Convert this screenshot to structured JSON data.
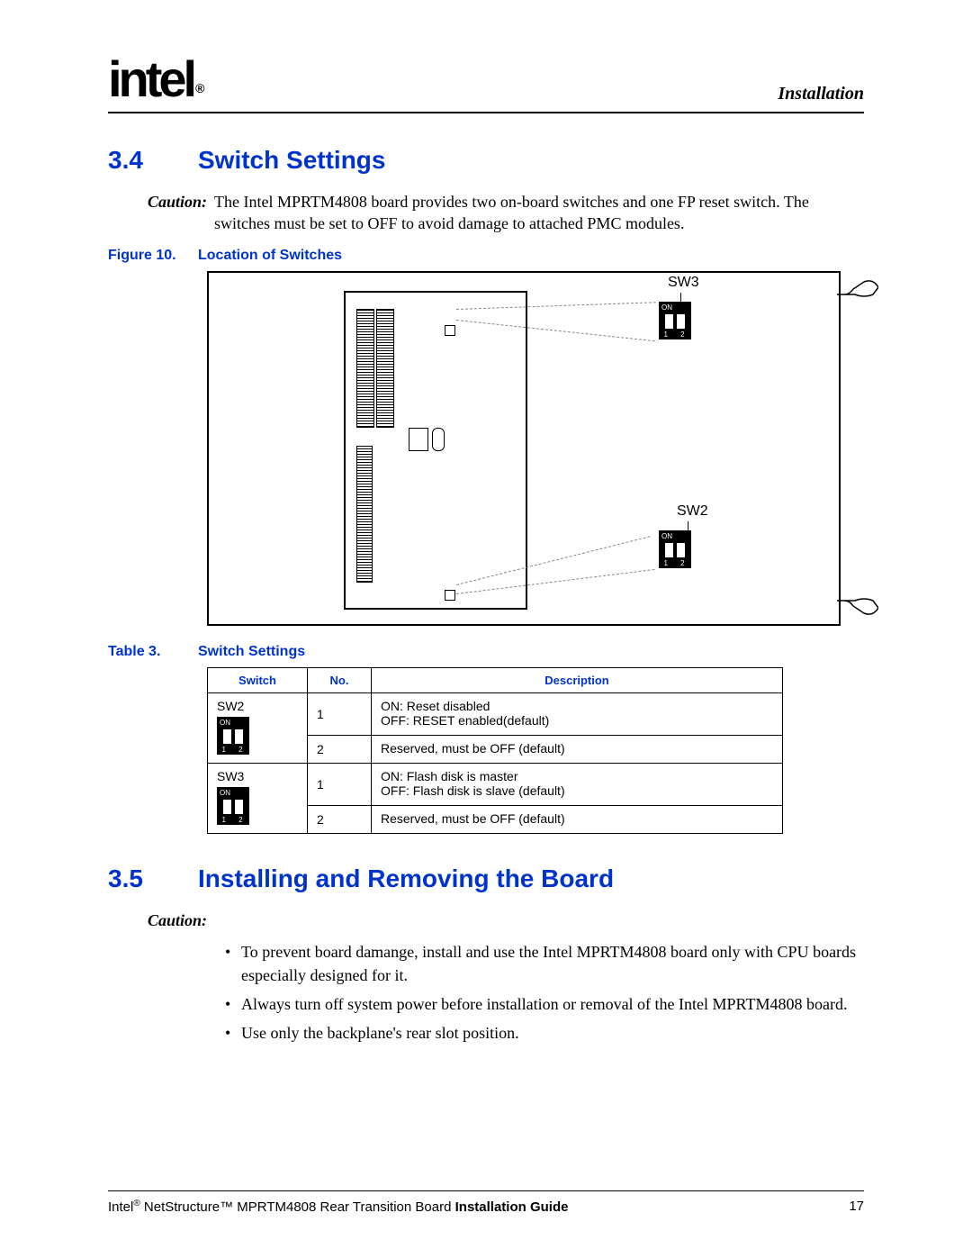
{
  "header": {
    "logo_text": "intel",
    "reg_mark": "®",
    "section_name": "Installation"
  },
  "section34": {
    "number": "3.4",
    "title": "Switch Settings",
    "caution_label": "Caution:",
    "caution_text": "The Intel MPRTM4808 board provides two on-board switches and one FP reset switch. The switches must be set to OFF to avoid damage to attached PMC modules."
  },
  "figure": {
    "label": "Figure 10.",
    "title": "Location of Switches",
    "sw3_label": "SW3",
    "sw2_label": "SW2",
    "dip_on": "ON",
    "dip_nums": "1 2"
  },
  "table": {
    "label": "Table 3.",
    "title": "Switch Settings",
    "headers": {
      "c1": "Switch",
      "c2": "No.",
      "c3": "Description"
    },
    "rows": [
      {
        "switch": "SW2",
        "sub": [
          {
            "no": "1",
            "desc_l1": "ON: Reset disabled",
            "desc_l2": "OFF: RESET enabled(default)"
          },
          {
            "no": "2",
            "desc_l1": "Reserved, must be OFF (default)",
            "desc_l2": ""
          }
        ]
      },
      {
        "switch": "SW3",
        "sub": [
          {
            "no": "1",
            "desc_l1": "ON: Flash disk is master",
            "desc_l2": "OFF: Flash disk is slave (default)"
          },
          {
            "no": "2",
            "desc_l1": "Reserved, must be OFF (default)",
            "desc_l2": ""
          }
        ]
      }
    ]
  },
  "section35": {
    "number": "3.5",
    "title": "Installing and Removing the Board",
    "caution_label": "Caution:",
    "bullets": [
      "To prevent board damange, install and use the Intel MPRTM4808 board only with CPU boards especially designed for it.",
      "Always turn off system power before installation or removal of the Intel MPRTM4808 board.",
      "Use only the backplane's rear slot position."
    ]
  },
  "footer": {
    "text_prefix": "Intel",
    "reg": "®",
    "text_mid": " NetStructure™ MPRTM4808 Rear Transition Board ",
    "text_bold": "Installation Guide",
    "page_no": "17"
  }
}
